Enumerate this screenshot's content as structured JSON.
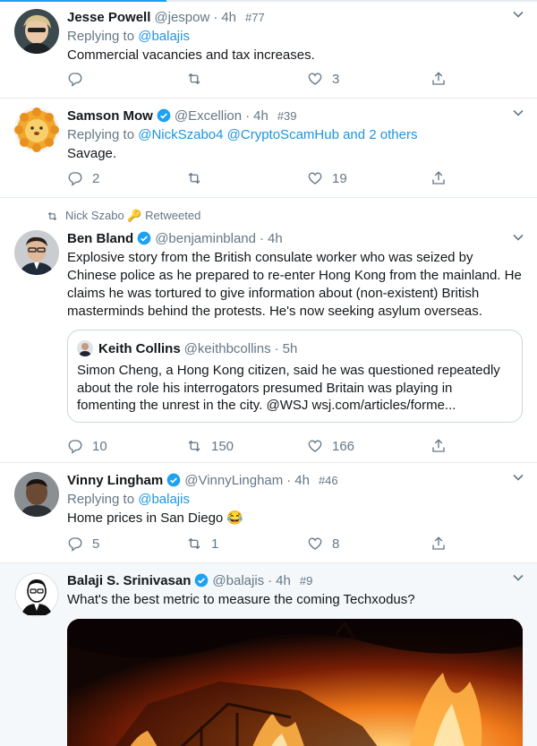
{
  "loading_progress": 0.31,
  "colors": {
    "accent": "#1da1f2",
    "link": "#1b95e0",
    "muted": "#657786",
    "border": "#e6ecf0"
  },
  "tweets": [
    {
      "name": "Jesse Powell",
      "verified": false,
      "handle": "@jespow",
      "dot": "·",
      "time": "4h",
      "rank": "#77",
      "replying_prefix": "Replying to",
      "replying_to": "@balajis",
      "text": "Commercial vacancies and tax increases.",
      "reply_count": "",
      "retweet_count": "",
      "like_count": "3"
    },
    {
      "name": "Samson Mow",
      "verified": true,
      "handle": "@Excellion",
      "dot": "·",
      "time": "4h",
      "rank": "#39",
      "replying_prefix": "Replying to",
      "replying_to": "@NickSzabo4 @CryptoScamHub and 2 others",
      "text": "Savage.",
      "reply_count": "2",
      "retweet_count": "",
      "like_count": "19"
    },
    {
      "retweeted_by": "Nick Szabo 🔑 Retweeted",
      "name": "Ben Bland",
      "verified": true,
      "handle": "@benjaminbland",
      "dot": "·",
      "time": "4h",
      "text": "Explosive story from the British consulate worker who was seized by Chinese police as he prepared to re-enter Hong Kong from the mainland. He claims he was tortured to give information about (non-existent) British masterminds behind the protests. He's now seeking asylum overseas.",
      "quote": {
        "name": "Keith Collins",
        "handle": "@keithbcollins",
        "dot": "·",
        "time": "5h",
        "text": "Simon Cheng, a Hong Kong citizen, said he was questioned repeatedly about the role his interrogators presumed Britain was playing in fomenting the unrest in the city. @WSJ wsj.com/articles/forme..."
      },
      "reply_count": "10",
      "retweet_count": "150",
      "like_count": "166"
    },
    {
      "name": "Vinny Lingham",
      "verified": true,
      "handle": "@VinnyLingham",
      "dot": "·",
      "time": "4h",
      "rank": "#46",
      "replying_prefix": "Replying to",
      "replying_to": "@balajis",
      "text": "Home prices in San Diego 😂",
      "reply_count": "5",
      "retweet_count": "1",
      "like_count": "8"
    },
    {
      "name": "Balaji S. Srinivasan",
      "verified": true,
      "handle": "@balajis",
      "dot": "·",
      "time": "4h",
      "rank": "#9",
      "text": "What's the best metric to measure the coming Techxodus?",
      "media": "burning-house-image"
    }
  ]
}
